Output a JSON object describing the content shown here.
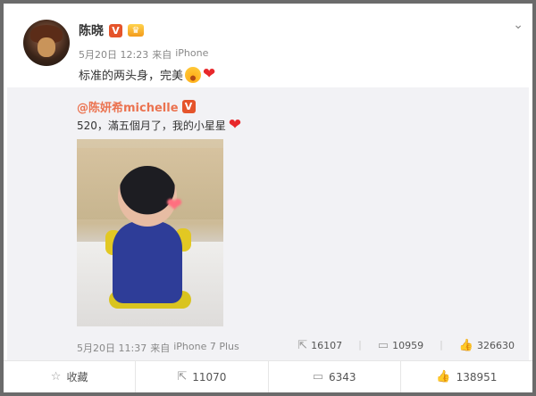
{
  "post": {
    "username": "陈晓",
    "verified_badge": "V",
    "member_badge": "♛",
    "date": "5月20日 12:23",
    "source_prefix": "来自",
    "source": "iPhone",
    "text": "标准的两头身，完美"
  },
  "repost": {
    "author": "@陈妍希michelle",
    "verified_badge": "V",
    "text": "520，滿五個月了，我的小星星",
    "date": "5月20日 11:37",
    "source_prefix": "来自",
    "source": "iPhone 7 Plus",
    "reposts": "16107",
    "comments": "10959",
    "likes": "326630"
  },
  "footer": {
    "favorite_label": "收藏",
    "repost_count": "11070",
    "comment_count": "6343",
    "like_count": "138951"
  },
  "colors": {
    "link": "#eb7350",
    "verified": "#e5542b",
    "repost_bg": "#f2f2f5"
  }
}
